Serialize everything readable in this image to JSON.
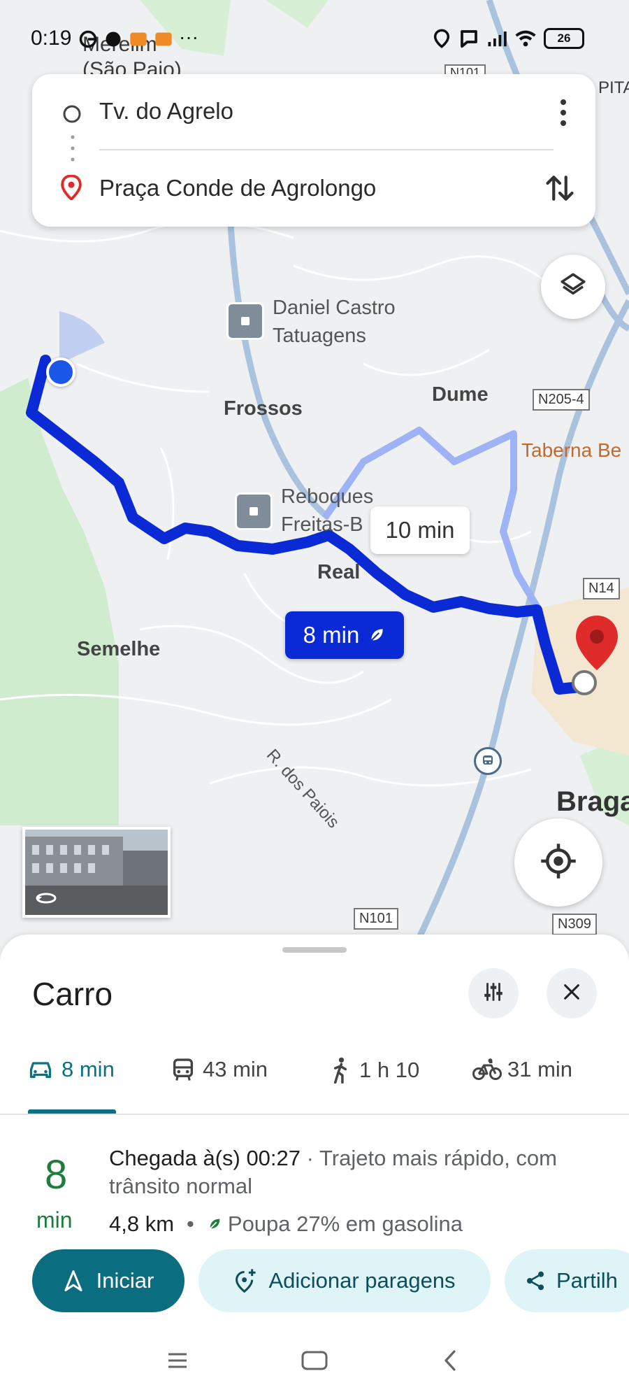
{
  "status_bar": {
    "time": "0:19",
    "battery": "26"
  },
  "search": {
    "origin": "Tv. do Agrelo",
    "destination": "Praça Conde de Agrolongo"
  },
  "map": {
    "labels": {
      "place_top_line1": "Merelim",
      "place_top_line2": "(São Paio)",
      "road_top": "N101",
      "pita_partial": "PITA",
      "poi1_line1": "Daniel Castro",
      "poi1_line2": "Tatuagens",
      "frossos": "Frossos",
      "dume": "Dume",
      "road_n205": "N205-4",
      "taberna": "Taberna Be",
      "poi2_line1": "Reboques",
      "poi2_line2": "Freitas-B",
      "real": "Real",
      "road_n14": "N14",
      "semelhe": "Semelhe",
      "street_paiois": "R. dos Paiois",
      "braga": "Braga",
      "road_n101": "N101",
      "road_n309": "N309"
    },
    "alt_route_time": "10 min",
    "main_route_time": "8 min"
  },
  "sheet": {
    "title": "Carro",
    "modes": [
      {
        "icon": "car-icon",
        "label": "8 min"
      },
      {
        "icon": "transit-icon",
        "label": "43 min"
      },
      {
        "icon": "walk-icon",
        "label": "1 h 10"
      },
      {
        "icon": "bike-icon",
        "label": "31 min"
      }
    ],
    "duration_number": "8",
    "duration_unit": "min",
    "arrival_text": "Chegada à(s) 00:27",
    "route_desc": " · Trajeto mais rápido, com trânsito normal",
    "distance": "4,8 km",
    "eco_text": "Poupa 27% em gasolina",
    "buttons": {
      "start": "Iniciar",
      "add_stops": "Adicionar paragens",
      "share": "Partilh"
    }
  },
  "colors": {
    "route": "#0a2ad6",
    "alt_route": "#9db3f5",
    "accent": "#0b7285",
    "pin": "#e02b2b"
  }
}
